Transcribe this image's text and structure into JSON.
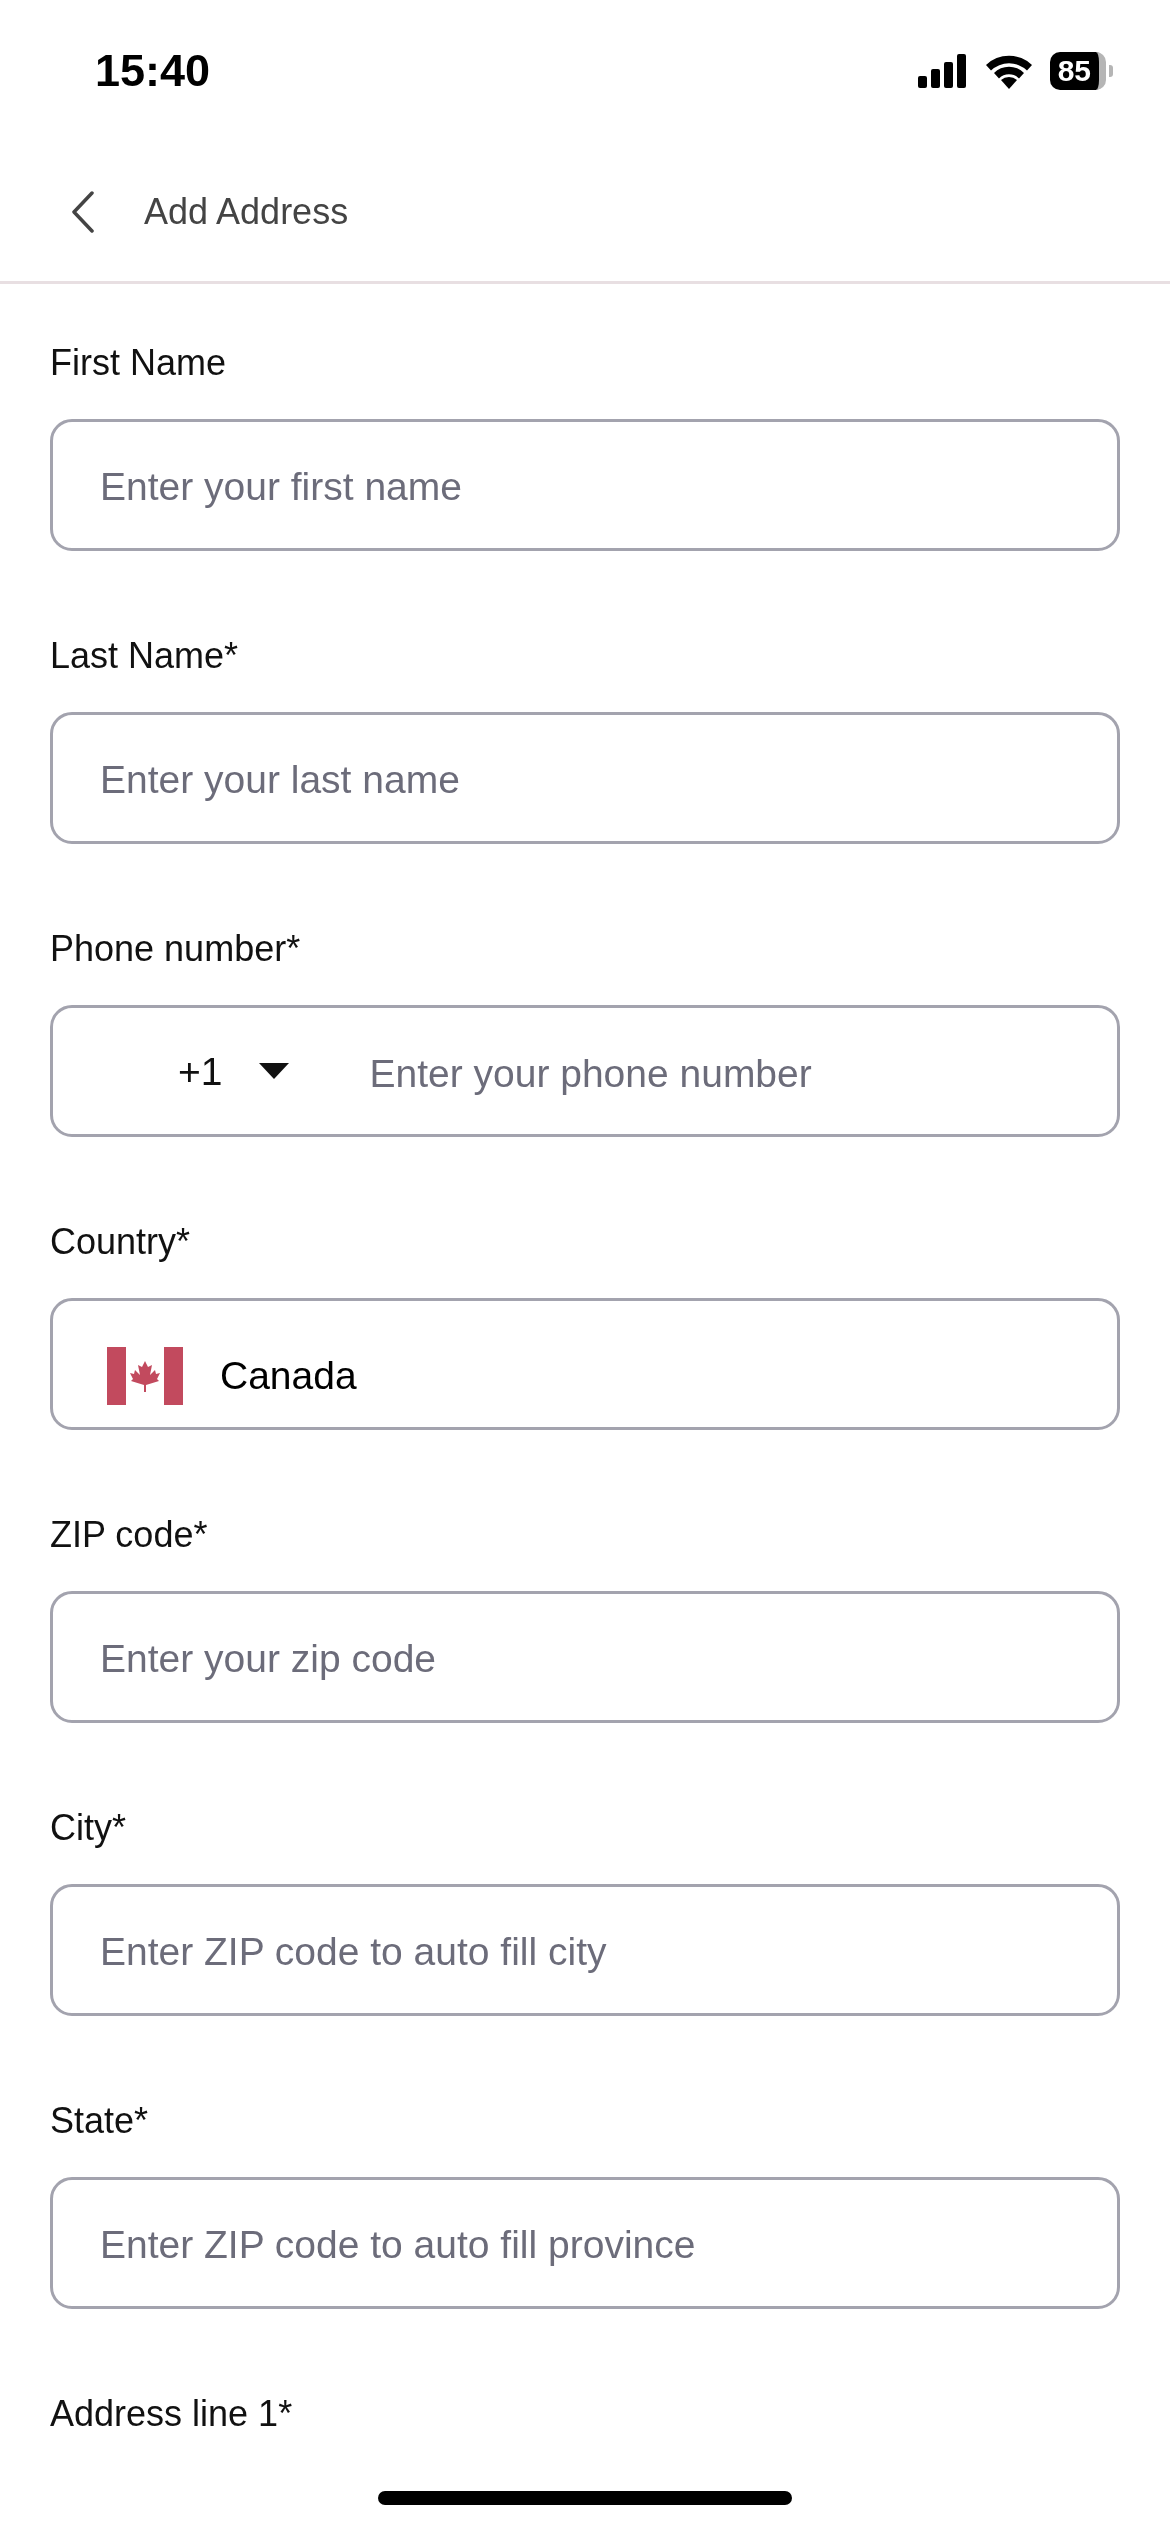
{
  "status_bar": {
    "time": "15:40",
    "battery": "85"
  },
  "header": {
    "title": "Add Address"
  },
  "fields": [
    {
      "kind": "text",
      "label": "First Name",
      "placeholder": "Enter your first name"
    },
    {
      "kind": "text",
      "label": "Last Name*",
      "placeholder": "Enter your last name"
    },
    {
      "kind": "phone",
      "label": "Phone number*",
      "code": "+1",
      "placeholder": "Enter your phone number"
    },
    {
      "kind": "country",
      "label": "Country*",
      "value": "Canada"
    },
    {
      "kind": "text",
      "label": "ZIP code*",
      "placeholder": "Enter your zip code"
    },
    {
      "kind": "text",
      "label": "City*",
      "placeholder": "Enter ZIP code to auto fill city"
    },
    {
      "kind": "text",
      "label": "State*",
      "placeholder": "Enter ZIP code to auto fill province"
    }
  ],
  "next_field": {
    "label": "Address line 1*"
  }
}
